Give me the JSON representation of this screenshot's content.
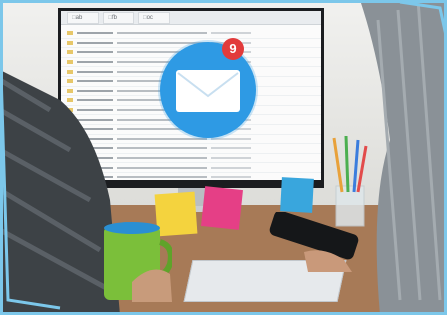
{
  "screen": {
    "tabs": [
      "ab",
      "fb",
      "oc"
    ]
  },
  "notification": {
    "count": "9",
    "icon": "envelope-icon",
    "badge_color": "#2e9ae4",
    "count_color": "#e23b3b"
  },
  "colors": {
    "frame_accent": "#7cc7ea",
    "desk": "#a77a57"
  }
}
